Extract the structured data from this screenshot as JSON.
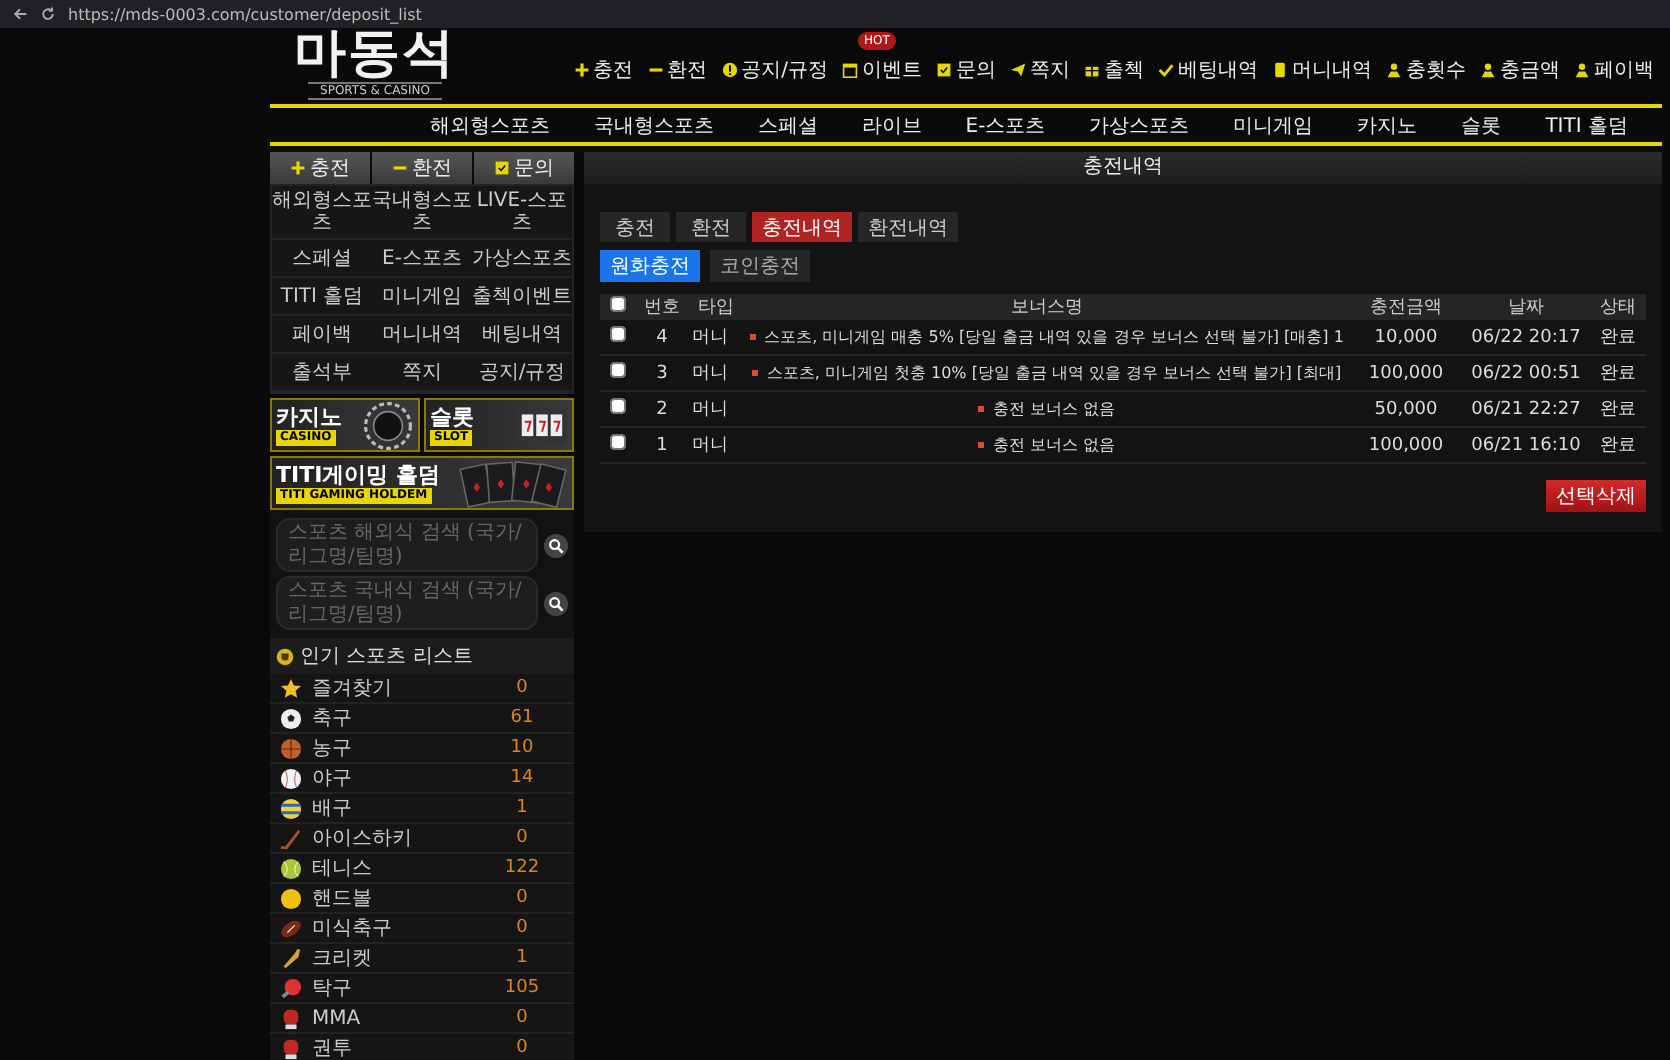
{
  "browser": {
    "url": "https://mds-0003.com/customer/deposit_list"
  },
  "logo": {
    "title": "마동석",
    "subtitle": "SPORTS & CASINO"
  },
  "top_links": [
    {
      "label": "충전",
      "kind": "plus"
    },
    {
      "label": "환전",
      "kind": "minus"
    },
    {
      "label": "공지/규정",
      "kind": "info"
    },
    {
      "label": "이벤트",
      "kind": "calendar",
      "badge": "HOT"
    },
    {
      "label": "문의",
      "kind": "chat"
    },
    {
      "label": "쪽지",
      "kind": "send"
    },
    {
      "label": "출첵",
      "kind": "gift"
    },
    {
      "label": "베팅내역",
      "kind": "check"
    },
    {
      "label": "머니내역",
      "kind": "wallet"
    },
    {
      "label": "충횟수",
      "kind": "user"
    },
    {
      "label": "충금액",
      "kind": "user"
    },
    {
      "label": "페이백",
      "kind": "user"
    }
  ],
  "nav": [
    "해외형스포츠",
    "국내형스포츠",
    "스페셜",
    "라이브",
    "E-스포츠",
    "가상스포츠",
    "미니게임",
    "카지노",
    "슬롯",
    "TITI 홀덤"
  ],
  "sidebar": {
    "actions": [
      {
        "label": "충전",
        "kind": "plus"
      },
      {
        "label": "환전",
        "kind": "minus"
      },
      {
        "label": "문의",
        "kind": "chat"
      }
    ],
    "menu": [
      "해외형스포츠",
      "국내형스포츠",
      "LIVE-스포츠",
      "스페셜",
      "E-스포츠",
      "가상스포츠",
      "TITI 홀덤",
      "미니게임",
      "출첵이벤트",
      "페이백",
      "머니내역",
      "베팅내역",
      "출석부",
      "쪽지",
      "공지/규정"
    ],
    "banners": [
      {
        "title": "카지노",
        "subtitle": "CASINO",
        "kind": "casino"
      },
      {
        "title": "슬롯",
        "subtitle": "SLOT",
        "kind": "slot"
      },
      {
        "title": "TITI게이밍 홀덤",
        "subtitle": "TITI GAMING HOLDEM",
        "kind": "cards"
      }
    ],
    "searches": [
      {
        "placeholder": "스포츠 해외식 검색 (국가/리그명/팀명)"
      },
      {
        "placeholder": "스포츠 국내식 검색 (국가/리그명/팀명)"
      }
    ],
    "popular_title": "인기 스포츠 리스트",
    "sports": [
      {
        "name": "즐겨찾기",
        "count": "0",
        "kind": "star"
      },
      {
        "name": "축구",
        "count": "61",
        "kind": "soccer"
      },
      {
        "name": "농구",
        "count": "10",
        "kind": "basketball"
      },
      {
        "name": "야구",
        "count": "14",
        "kind": "baseball"
      },
      {
        "name": "배구",
        "count": "1",
        "kind": "volleyball"
      },
      {
        "name": "아이스하키",
        "count": "0",
        "kind": "hockey"
      },
      {
        "name": "테니스",
        "count": "122",
        "kind": "tennis"
      },
      {
        "name": "핸드볼",
        "count": "0",
        "kind": "handball"
      },
      {
        "name": "미식축구",
        "count": "0",
        "kind": "football"
      },
      {
        "name": "크리켓",
        "count": "1",
        "kind": "cricket"
      },
      {
        "name": "탁구",
        "count": "105",
        "kind": "pingpong"
      },
      {
        "name": "MMA",
        "count": "0",
        "kind": "glove"
      },
      {
        "name": "권투",
        "count": "0",
        "kind": "glove"
      }
    ]
  },
  "main": {
    "title": "충전내역",
    "tabs": [
      {
        "label": "충전",
        "selected": false
      },
      {
        "label": "환전",
        "selected": false
      },
      {
        "label": "충전내역",
        "selected": true
      },
      {
        "label": "환전내역",
        "selected": false
      }
    ],
    "subtabs": [
      {
        "label": "원화충전",
        "selected": true
      },
      {
        "label": "코인충전",
        "selected": false
      }
    ],
    "table": {
      "all_checked": false,
      "columns": [
        "번호",
        "타입",
        "보너스명",
        "충전금액",
        "날짜",
        "상태"
      ],
      "rows": [
        {
          "checked": false,
          "no": "4",
          "type": "머니",
          "bonus": "스포츠, 미니게임 매충 5% [당일 출금 내역 있을 경우 보너스 선택 불가] [매충] 1",
          "amount": "10,000",
          "date": "06/22 20:17",
          "status": "완료"
        },
        {
          "checked": false,
          "no": "3",
          "type": "머니",
          "bonus": "스포츠, 미니게임 첫충 10% [당일 출금 내역 있을 경우 보너스 선택 불가] [최대]",
          "amount": "100,000",
          "date": "06/22 00:51",
          "status": "완료"
        },
        {
          "checked": false,
          "no": "2",
          "type": "머니",
          "bonus": "충전 보너스 없음",
          "amount": "50,000",
          "date": "06/21 22:27",
          "status": "완료"
        },
        {
          "checked": false,
          "no": "1",
          "type": "머니",
          "bonus": "충전 보너스 없음",
          "amount": "100,000",
          "date": "06/21 16:10",
          "status": "완료"
        }
      ]
    },
    "delete_button": "선택삭제"
  }
}
